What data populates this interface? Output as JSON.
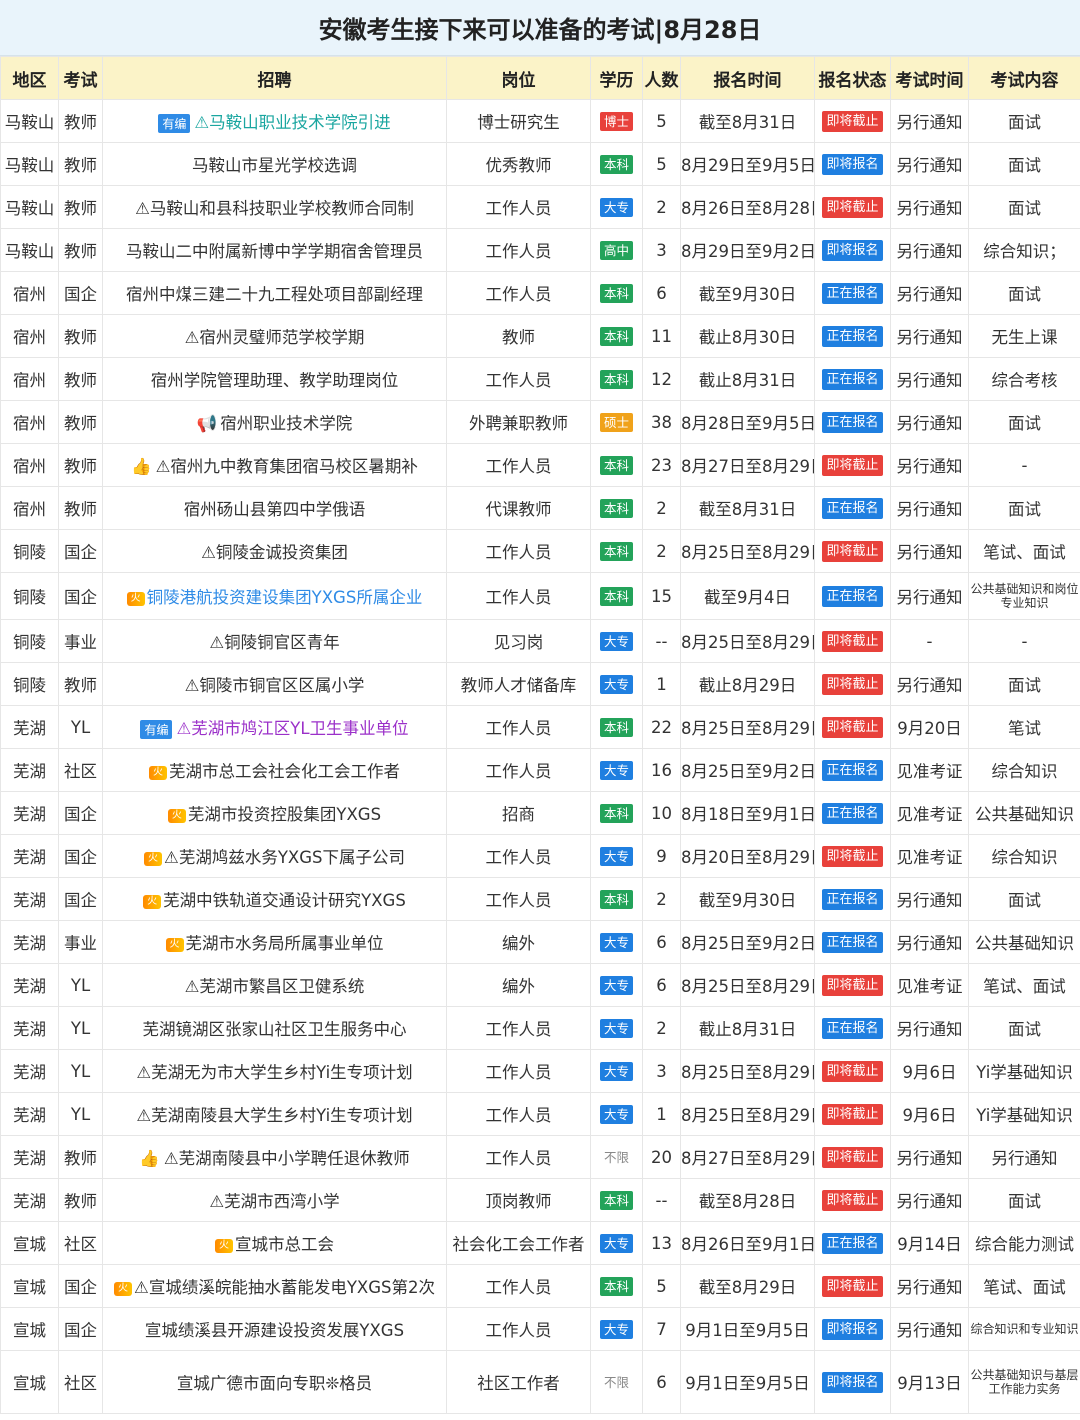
{
  "title": "安徽考生接下来可以准备的考试|8月28日",
  "headers": [
    "地区",
    "考试",
    "招聘",
    "岗位",
    "学历",
    "人数",
    "报名时间",
    "报名状态",
    "考试时间",
    "考试内容"
  ],
  "rows": [
    {
      "region": "马鞍山",
      "type": "教师",
      "prefix": "有编",
      "recruit": "⚠马鞍山职业技术学院引进",
      "position": "博士研究生",
      "edu": "博士",
      "count": "5",
      "reg": "截至8月31日",
      "status": "即将截止",
      "exam": "另行通知",
      "content": "面试"
    },
    {
      "region": "马鞍山",
      "type": "教师",
      "recruit": "马鞍山市星光学校选调",
      "position": "优秀教师",
      "edu": "本科",
      "count": "5",
      "reg": "8月29日至9月5日",
      "status": "即将报名",
      "exam": "另行通知",
      "content": "面试"
    },
    {
      "region": "马鞍山",
      "type": "教师",
      "recruit": "⚠马鞍山和县科技职业学校教师合同制",
      "position": "工作人员",
      "edu": "大专",
      "count": "2",
      "reg": "8月26日至8月28日",
      "status": "即将截止",
      "exam": "另行通知",
      "content": "面试"
    },
    {
      "region": "马鞍山",
      "type": "教师",
      "recruit": "马鞍山二中附属新博中学学期宿舍管理员",
      "position": "工作人员",
      "edu": "高中",
      "count": "3",
      "reg": "8月29日至9月2日",
      "status": "即将报名",
      "exam": "另行通知",
      "content": "综合知识；"
    },
    {
      "region": "宿州",
      "type": "国企",
      "recruit": "宿州中煤三建二十九工程处项目部副经理",
      "position": "工作人员",
      "edu": "本科",
      "count": "6",
      "reg": "截至9月30日",
      "status": "正在报名",
      "exam": "另行通知",
      "content": "面试"
    },
    {
      "region": "宿州",
      "type": "教师",
      "recruit": "⚠宿州灵璧师范学校学期",
      "position": "教师",
      "edu": "本科",
      "count": "11",
      "reg": "截止8月30日",
      "status": "正在报名",
      "exam": "另行通知",
      "content": "无生上课"
    },
    {
      "region": "宿州",
      "type": "教师",
      "recruit": "宿州学院管理助理、教学助理岗位",
      "position": "工作人员",
      "edu": "本科",
      "count": "12",
      "reg": "截止8月31日",
      "status": "正在报名",
      "exam": "另行通知",
      "content": "综合考核"
    },
    {
      "region": "宿州",
      "type": "教师",
      "recruit": "宿州职业技术学院",
      "position": "外聘兼职教师",
      "edu": "硕士",
      "count": "38",
      "reg": "8月28日至9月5日",
      "status": "正在报名",
      "exam": "另行通知",
      "content": "面试"
    },
    {
      "region": "宿州",
      "type": "教师",
      "recruit": "⚠宿州九中教育集团宿马校区暑期补",
      "position": "工作人员",
      "edu": "本科",
      "count": "23",
      "reg": "8月27日至8月29日",
      "status": "即将截止",
      "exam": "另行通知",
      "content": "-"
    },
    {
      "region": "宿州",
      "type": "教师",
      "recruit": "宿州砀山县第四中学俄语",
      "position": "代课教师",
      "edu": "本科",
      "count": "2",
      "reg": "截至8月31日",
      "status": "正在报名",
      "exam": "另行通知",
      "content": "面试"
    },
    {
      "region": "铜陵",
      "type": "国企",
      "recruit": "⚠铜陵金诚投资集团",
      "position": "工作人员",
      "edu": "本科",
      "count": "2",
      "reg": "8月25日至8月29日",
      "status": "即将截止",
      "exam": "另行通知",
      "content": "笔试、面试"
    },
    {
      "region": "铜陵",
      "type": "国企",
      "recruit": "铜陵港航投资建设集团YXGS所属企业",
      "position": "工作人员",
      "edu": "本科",
      "count": "15",
      "reg": "截至9月4日",
      "status": "正在报名",
      "exam": "另行通知",
      "content": "公共基础知识和岗位专业知识"
    },
    {
      "region": "铜陵",
      "type": "事业",
      "recruit": "⚠铜陵铜官区青年",
      "position": "见习岗",
      "edu": "大专",
      "count": "--",
      "reg": "8月25日至8月29日",
      "status": "即将截止",
      "exam": "-",
      "content": "-"
    },
    {
      "region": "铜陵",
      "type": "教师",
      "recruit": "⚠铜陵市铜官区区属小学",
      "position": "教师人才储备库",
      "edu": "大专",
      "count": "1",
      "reg": "截止8月29日",
      "status": "即将截止",
      "exam": "另行通知",
      "content": "面试"
    },
    {
      "region": "芜湖",
      "type": "YL",
      "prefix": "有编",
      "recruit": "⚠芜湖市鸠江区YL卫生事业单位",
      "position": "工作人员",
      "edu": "本科",
      "count": "22",
      "reg": "8月25日至8月29日",
      "status": "即将截止",
      "exam": "9月20日",
      "content": "笔试"
    },
    {
      "region": "芜湖",
      "type": "社区",
      "recruit": "芜湖市总工会社会化工会工作者",
      "position": "工作人员",
      "edu": "大专",
      "count": "16",
      "reg": "8月25日至9月2日",
      "status": "正在报名",
      "exam": "见准考证",
      "content": "综合知识"
    },
    {
      "region": "芜湖",
      "type": "国企",
      "recruit": "芜湖市投资控股集团YXGS",
      "position": "招商",
      "edu": "本科",
      "count": "10",
      "reg": "8月18日至9月1日",
      "status": "正在报名",
      "exam": "见准考证",
      "content": "公共基础知识"
    },
    {
      "region": "芜湖",
      "type": "国企",
      "recruit": "⚠芜湖鸠兹水务YXGS下属子公司",
      "position": "工作人员",
      "edu": "大专",
      "count": "9",
      "reg": "8月20日至8月29日",
      "status": "即将截止",
      "exam": "见准考证",
      "content": "综合知识"
    },
    {
      "region": "芜湖",
      "type": "国企",
      "recruit": "芜湖中铁轨道交通设计研究YXGS",
      "position": "工作人员",
      "edu": "本科",
      "count": "2",
      "reg": "截至9月30日",
      "status": "正在报名",
      "exam": "另行通知",
      "content": "面试"
    },
    {
      "region": "芜湖",
      "type": "事业",
      "recruit": "芜湖市水务局所属事业单位",
      "position": "编外",
      "edu": "大专",
      "count": "6",
      "reg": "8月25日至9月2日",
      "status": "正在报名",
      "exam": "另行通知",
      "content": "公共基础知识"
    },
    {
      "region": "芜湖",
      "type": "YL",
      "recruit": "⚠芜湖市繁昌区卫健系统",
      "position": "编外",
      "edu": "大专",
      "count": "6",
      "reg": "8月25日至8月29日",
      "status": "即将截止",
      "exam": "见准考证",
      "content": "笔试、面试"
    },
    {
      "region": "芜湖",
      "type": "YL",
      "recruit": "芜湖镜湖区张家山社区卫生服务中心",
      "position": "工作人员",
      "edu": "大专",
      "count": "2",
      "reg": "截止8月31日",
      "status": "正在报名",
      "exam": "另行通知",
      "content": "面试"
    },
    {
      "region": "芜湖",
      "type": "YL",
      "recruit": "⚠芜湖无为市大学生乡村Yi生专项计划",
      "position": "工作人员",
      "edu": "大专",
      "count": "3",
      "reg": "8月25日至8月29日",
      "status": "即将截止",
      "exam": "9月6日",
      "content": "Yi学基础知识"
    },
    {
      "region": "芜湖",
      "type": "YL",
      "recruit": "⚠芜湖南陵县大学生乡村Yi生专项计划",
      "position": "工作人员",
      "edu": "大专",
      "count": "1",
      "reg": "8月25日至8月29日",
      "status": "即将截止",
      "exam": "9月6日",
      "content": "Yi学基础知识"
    },
    {
      "region": "芜湖",
      "type": "教师",
      "recruit": "⚠芜湖南陵县中小学聘任退休教师",
      "position": "工作人员",
      "edu": "不限",
      "count": "20",
      "reg": "8月27日至8月29日",
      "status": "即将截止",
      "exam": "另行通知",
      "content": "另行通知"
    },
    {
      "region": "芜湖",
      "type": "教师",
      "recruit": "⚠芜湖市西湾小学",
      "position": "顶岗教师",
      "edu": "本科",
      "count": "--",
      "reg": "截至8月28日",
      "status": "即将截止",
      "exam": "另行通知",
      "content": "面试"
    },
    {
      "region": "宣城",
      "type": "社区",
      "recruit": "宣城市总工会",
      "position": "社会化工会工作者",
      "edu": "大专",
      "count": "13",
      "reg": "8月26日至9月1日",
      "status": "正在报名",
      "exam": "9月14日",
      "content": "综合能力测试"
    },
    {
      "region": "宣城",
      "type": "国企",
      "recruit": "⚠宣城绩溪皖能抽水蓄能发电YXGS第2次",
      "position": "工作人员",
      "edu": "本科",
      "count": "5",
      "reg": "截至8月29日",
      "status": "即将截止",
      "exam": "另行通知",
      "content": "笔试、面试"
    },
    {
      "region": "宣城",
      "type": "国企",
      "recruit": "宣城绩溪县开源建设投资发展YXGS",
      "position": "工作人员",
      "edu": "大专",
      "count": "7",
      "reg": "9月1日至9月5日",
      "status": "即将报名",
      "exam": "另行通知",
      "content": "综合知识和专业知识"
    },
    {
      "region": "宣城",
      "type": "社区",
      "recruit": "宣城广德市面向专职❊格员",
      "position": "社区工作者",
      "edu": "不限",
      "count": "6",
      "reg": "9月1日至9月5日",
      "status": "即将报名",
      "exam": "9月13日",
      "content": "公共基础知识与基层工作能力实务"
    }
  ]
}
